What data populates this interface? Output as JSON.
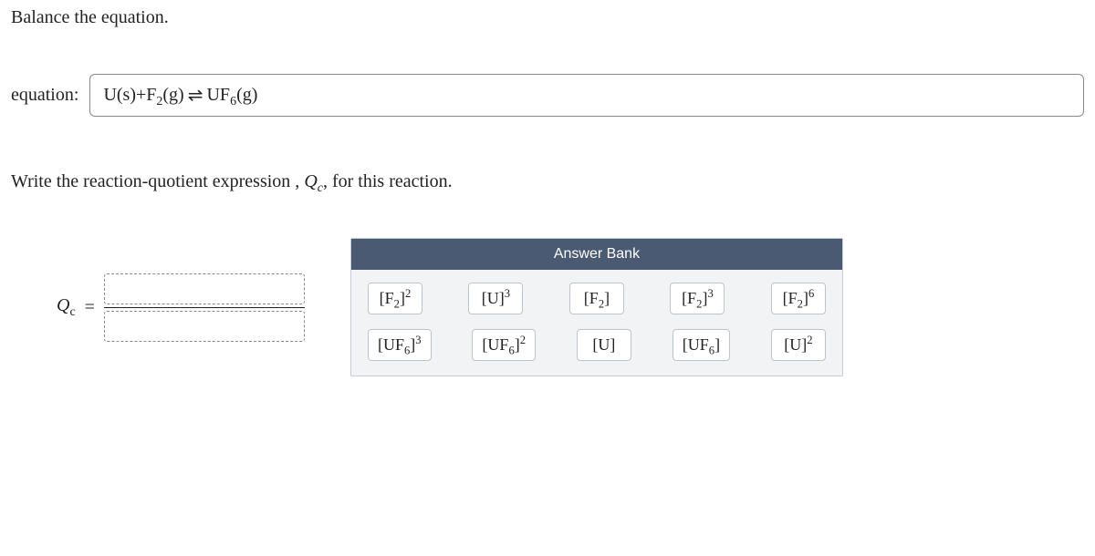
{
  "instruction1": "Balance the equation.",
  "equation": {
    "label": "equation:",
    "parts": {
      "u": "U(s)",
      "plus": " + ",
      "f2": "F",
      "f2sub": "2",
      "f2phase": "(g)",
      "arrow": "⇌",
      "uf6": "UF",
      "uf6sub": "6",
      "uf6phase": "(g)"
    }
  },
  "instruction2_a": "Write the reaction-quotient expression , ",
  "instruction2_q": "Q",
  "instruction2_c": "c",
  "instruction2_b": ", for this reaction.",
  "qc": {
    "Q": "Q",
    "c": "c",
    "eq": "="
  },
  "bank": {
    "title": "Answer Bank",
    "rows": [
      [
        {
          "base": "[F",
          "sub": "2",
          "mid": "]",
          "sup": "2",
          "tail": ""
        },
        {
          "base": "[U]",
          "sub": "",
          "mid": "",
          "sup": "3",
          "tail": ""
        },
        {
          "base": "[F",
          "sub": "2",
          "mid": "]",
          "sup": "",
          "tail": ""
        },
        {
          "base": "[F",
          "sub": "2",
          "mid": "]",
          "sup": "3",
          "tail": ""
        },
        {
          "base": "[F",
          "sub": "2",
          "mid": "]",
          "sup": "6",
          "tail": ""
        }
      ],
      [
        {
          "base": "[UF",
          "sub": "6",
          "mid": "]",
          "sup": "3",
          "tail": ""
        },
        {
          "base": "[UF",
          "sub": "6",
          "mid": "]",
          "sup": "2",
          "tail": ""
        },
        {
          "base": "[U]",
          "sub": "",
          "mid": "",
          "sup": "",
          "tail": ""
        },
        {
          "base": "[UF",
          "sub": "6",
          "mid": "]",
          "sup": "",
          "tail": ""
        },
        {
          "base": "[U]",
          "sub": "",
          "mid": "",
          "sup": "2",
          "tail": ""
        }
      ]
    ]
  }
}
